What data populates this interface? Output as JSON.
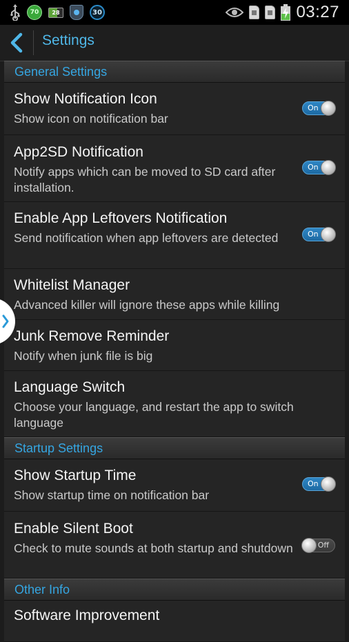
{
  "statusbar": {
    "left_icons": [
      {
        "name": "usb-icon"
      },
      {
        "name": "green-badge-icon",
        "text": "70"
      },
      {
        "name": "battery-saver-icon",
        "text": "28"
      },
      {
        "name": "shield-icon"
      },
      {
        "name": "blue-badge-icon",
        "text": "30"
      }
    ],
    "right_icons": [
      "eye-icon",
      "sim1-icon",
      "sim2-icon",
      "battery-charging-icon"
    ],
    "time": "03:27"
  },
  "actionbar": {
    "title": "Settings"
  },
  "sections": {
    "general": "General Settings",
    "startup": "Startup Settings",
    "other": "Other Info"
  },
  "items": {
    "notif_icon": {
      "title": "Show Notification Icon",
      "sub": "Show icon on notification bar",
      "toggle": "On"
    },
    "app2sd": {
      "title": "App2SD Notification",
      "sub": "Notify apps which can be moved to SD card after installation.",
      "toggle": "On"
    },
    "leftovers": {
      "title": "Enable App Leftovers Notification",
      "sub": "Send notification when app leftovers are detected",
      "toggle": "On"
    },
    "whitelist": {
      "title": "Whitelist Manager",
      "sub": "Advanced killer will ignore these apps while killing"
    },
    "junk": {
      "title": "Junk Remove Reminder",
      "sub": "Notify when junk file is big"
    },
    "language": {
      "title": "Language Switch",
      "sub": "Choose your language, and restart the app to switch language"
    },
    "startup_time": {
      "title": "Show Startup Time",
      "sub": "Show startup time on notification bar",
      "toggle": "On"
    },
    "silent_boot": {
      "title": "Enable Silent Boot",
      "sub": "Check to mute sounds at both startup and shutdown",
      "toggle": "Off"
    },
    "software": {
      "title": "Software Improvement"
    }
  },
  "colors": {
    "accent": "#35a6e2",
    "background": "#1c1c1c",
    "row": "#252525"
  }
}
